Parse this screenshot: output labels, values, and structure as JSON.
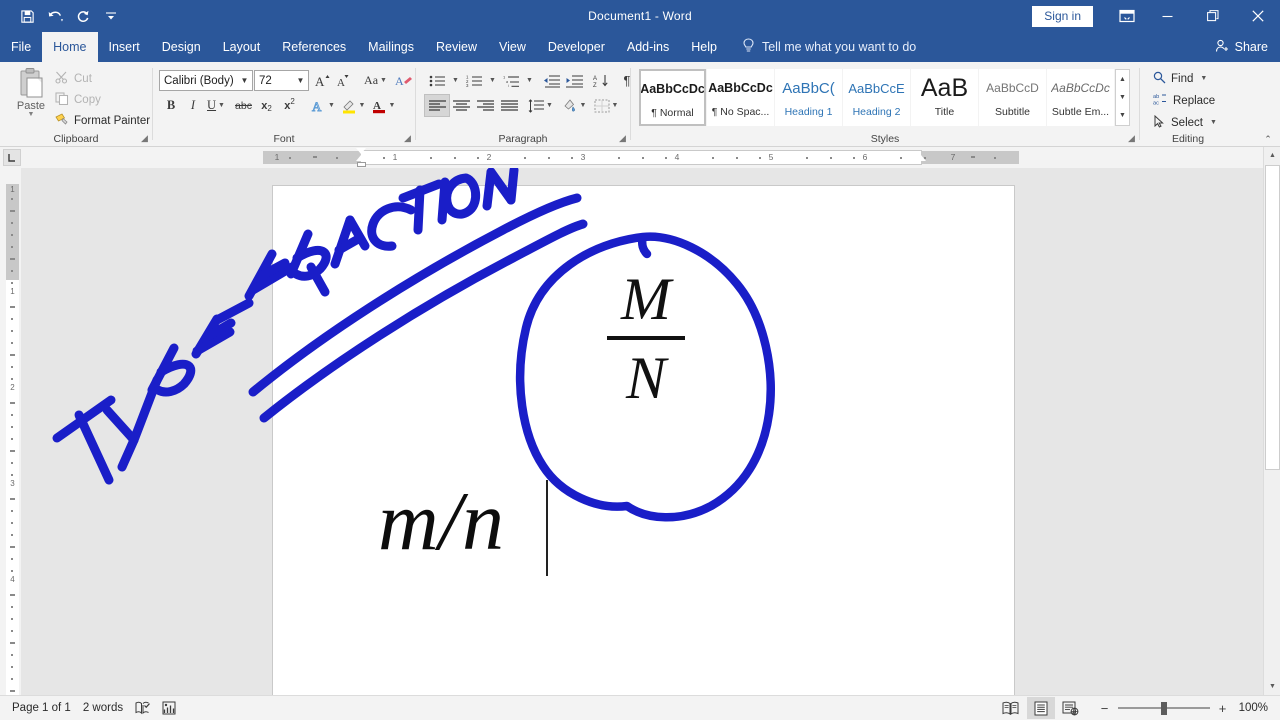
{
  "window": {
    "title": "Document1  -  Word",
    "signin_label": "Sign in",
    "quick_access": [
      {
        "name": "save-icon",
        "tooltip": "Save"
      },
      {
        "name": "undo-icon",
        "tooltip": "Undo"
      },
      {
        "name": "redo-icon",
        "tooltip": "Redo"
      },
      {
        "name": "customize-quick-access-icon",
        "tooltip": "Customize Quick Access Toolbar"
      }
    ],
    "controls": [
      {
        "name": "ribbon-display-options-icon"
      },
      {
        "name": "minimize-icon"
      },
      {
        "name": "restore-icon"
      },
      {
        "name": "close-icon"
      }
    ]
  },
  "tabs": [
    {
      "label": "File",
      "active": false
    },
    {
      "label": "Home",
      "active": true
    },
    {
      "label": "Insert",
      "active": false
    },
    {
      "label": "Design",
      "active": false
    },
    {
      "label": "Layout",
      "active": false
    },
    {
      "label": "References",
      "active": false
    },
    {
      "label": "Mailings",
      "active": false
    },
    {
      "label": "Review",
      "active": false
    },
    {
      "label": "View",
      "active": false
    },
    {
      "label": "Developer",
      "active": false
    },
    {
      "label": "Add-ins",
      "active": false
    },
    {
      "label": "Help",
      "active": false
    }
  ],
  "tellme": {
    "placeholder": "Tell me what you want to do",
    "icon": "lightbulb-icon"
  },
  "share": {
    "label": "Share",
    "icon": "share-person-icon"
  },
  "ribbon": {
    "clipboard": {
      "group_label": "Clipboard",
      "paste_label": "Paste",
      "cut_label": "Cut",
      "copy_label": "Copy",
      "format_painter_label": "Format Painter"
    },
    "font": {
      "group_label": "Font",
      "font_name": "Calibri (Body)",
      "font_size": "72",
      "buttons": [
        "grow-font",
        "shrink-font",
        "change-case",
        "clear-formatting",
        "bold",
        "italic",
        "underline",
        "strikethrough",
        "subscript",
        "superscript",
        "text-effects",
        "text-highlight-color",
        "font-color"
      ]
    },
    "paragraph": {
      "group_label": "Paragraph",
      "buttons": [
        "bullets",
        "numbering",
        "multilevel-list",
        "decrease-indent",
        "increase-indent",
        "sort",
        "show-formatting-marks",
        "align-left",
        "align-center",
        "align-right",
        "justify",
        "line-spacing",
        "shading",
        "borders"
      ],
      "active_alignment": "align-left"
    },
    "styles": {
      "group_label": "Styles",
      "items": [
        {
          "preview": "AaBbCcDc",
          "name": "¶ Normal",
          "active": true
        },
        {
          "preview": "AaBbCcDc",
          "name": "¶ No Spac...",
          "active": false
        },
        {
          "preview": "AaBbC(",
          "name": "Heading 1",
          "active": false
        },
        {
          "preview": "AaBbCcE",
          "name": "Heading 2",
          "active": false
        },
        {
          "preview": "AaB",
          "name": "Title",
          "active": false
        },
        {
          "preview": "AaBbCcD",
          "name": "Subtitle",
          "active": false
        },
        {
          "preview": "AaBbCcDc",
          "name": "Subtle Em...",
          "active": false
        }
      ]
    },
    "editing": {
      "group_label": "Editing",
      "find_label": "Find",
      "replace_label": "Replace",
      "select_label": "Select"
    }
  },
  "ruler": {
    "horizontal_numbers": [
      "1",
      "1",
      "2",
      "3",
      "4",
      "5",
      "6",
      "7"
    ],
    "vertical_numbers": [
      "1",
      "1",
      "2",
      "3",
      "4"
    ]
  },
  "document": {
    "typed_text": "m/n",
    "annotation_text": "TYPE FRACTION",
    "fraction": {
      "numerator": "M",
      "denominator": "N"
    },
    "ink_color": "#1a1ec8"
  },
  "status": {
    "page_label": "Page 1 of 1",
    "word_count": "2 words",
    "proofing_icon": "proofing-errors-icon",
    "accessibility_icon": "accessibility-checker-icon",
    "views": [
      {
        "name": "read-mode-view",
        "active": false
      },
      {
        "name": "print-layout-view",
        "active": true
      },
      {
        "name": "web-layout-view",
        "active": false
      }
    ],
    "zoom_out": "−",
    "zoom_in": "+",
    "zoom_level": "100%"
  }
}
